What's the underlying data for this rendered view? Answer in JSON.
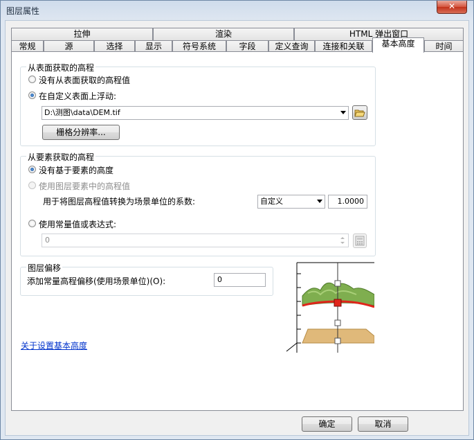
{
  "window": {
    "title": "图层属性",
    "close_label": "✕"
  },
  "tabs": {
    "row1": [
      "拉伸",
      "渲染",
      "HTML 弹出窗口"
    ],
    "row2": [
      "常规",
      "源",
      "选择",
      "显示",
      "符号系统",
      "字段",
      "定义查询",
      "连接和关联",
      "基本高度",
      "时间"
    ],
    "active": "基本高度"
  },
  "surface_group": {
    "title": "从表面获取的高程",
    "option_none": "没有从表面获取的高程值",
    "option_float": "在自定义表面上浮动:",
    "surface_path": "D:\\测图\\data\\DEM.tif",
    "raster_button": "栅格分辨率..."
  },
  "feature_group": {
    "title": "从要素获取的高程",
    "option_no_feature": "没有基于要素的高度",
    "option_layer_values": "使用图层要素中的高程值",
    "factor_label": "用于将图层高程值转换为场景单位的系数:",
    "factor_unit": "自定义",
    "factor_value": "1.0000",
    "option_expression": "使用常量值或表达式:",
    "expression_value": "0"
  },
  "offset_group": {
    "title": "图层偏移",
    "offset_label": "添加常量高程偏移(使用场景单位)(O):",
    "offset_value": "0"
  },
  "help_link": "关于设置基本高度",
  "footer": {
    "ok": "确定",
    "cancel": "取消"
  },
  "colors": {
    "terrain": "#7fae4f",
    "plane": "#e0b97a",
    "surface_line": "#e0251b"
  }
}
